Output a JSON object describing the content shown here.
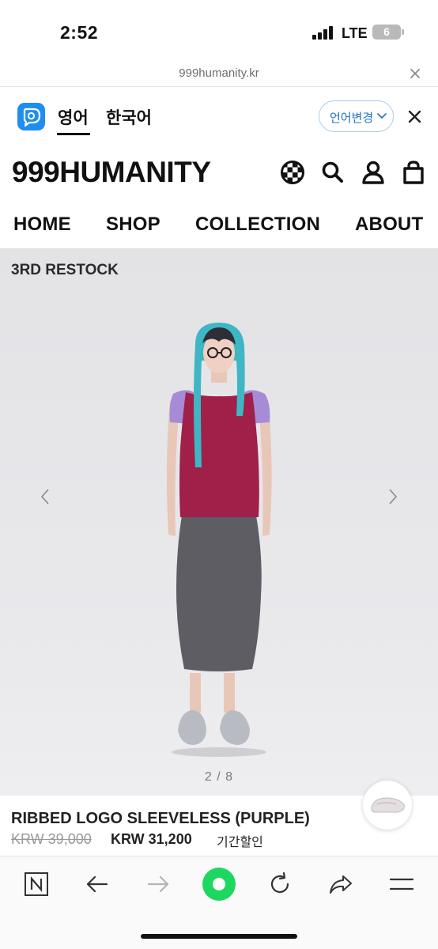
{
  "status_bar": {
    "time": "2:52",
    "network": "LTE",
    "battery": "6"
  },
  "browser": {
    "url": "999humanity.kr"
  },
  "translate_bar": {
    "lang_english": "영어",
    "lang_korean": "한국어",
    "change_label": "언어변경"
  },
  "site": {
    "brand": "999HUMANITY",
    "nav": [
      "HOME",
      "SHOP",
      "COLLECTION",
      "ABOUT"
    ]
  },
  "hero": {
    "badge": "3RD RESTOCK",
    "pager": "2 / 8"
  },
  "product": {
    "name": "RIBBED LOGO SLEEVELESS (PURPLE)",
    "price_original": "KRW 39,000",
    "price_sale": "KRW 31,200",
    "discount_label": "기간할인"
  },
  "colors": {
    "papago": "#1e8ef0",
    "active_green": "#1ed760",
    "link_blue": "#1f73c9"
  },
  "icons": {
    "header": [
      "checker-globe-icon",
      "search-icon",
      "user-icon",
      "shopping-bag-icon"
    ],
    "toolbar": [
      "naver-n-icon",
      "back-arrow-icon",
      "forward-arrow-icon",
      "green-home-icon",
      "reload-icon",
      "share-icon",
      "menu-icon"
    ]
  }
}
